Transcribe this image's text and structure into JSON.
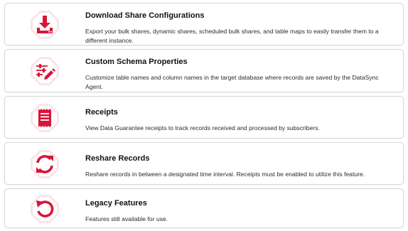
{
  "accent_color": "#d9143a",
  "items": [
    {
      "icon": "download-icon",
      "title": "Download Share Configurations",
      "description": "Export your bulk shares, dynamic shares, scheduled bulk shares, and table maps to easily transfer them to a different instance."
    },
    {
      "icon": "sliders-pencil-icon",
      "title": "Custom Schema Properties",
      "description": "Customize table names and column names in the target database where records are saved by the DataSync Agent."
    },
    {
      "icon": "receipt-icon",
      "title": "Receipts",
      "description": "View Data Guarantee receipts to track records received and processed by subscribers."
    },
    {
      "icon": "refresh-icon",
      "title": "Reshare Records",
      "description": "Reshare records in between a designated time interval. Receipts must be enabled to utilize this feature."
    },
    {
      "icon": "undo-icon",
      "title": "Legacy Features",
      "description": "Features still available for use."
    }
  ]
}
